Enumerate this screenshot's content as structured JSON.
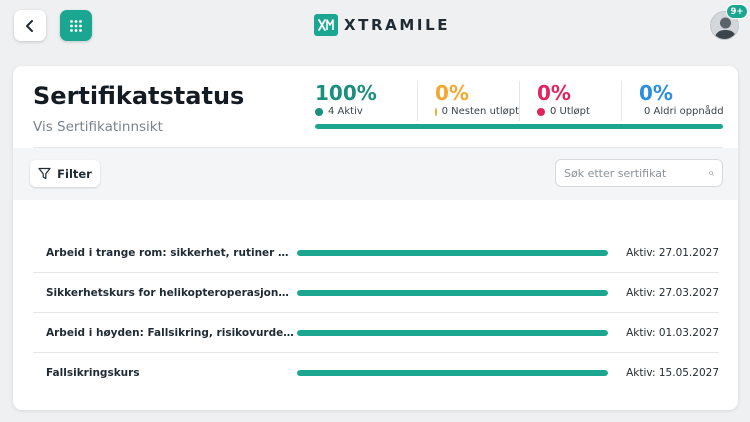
{
  "colors": {
    "accent": "#1aa691",
    "active": "#1a8f7b",
    "expiring": "#f0a830",
    "expired": "#e0245e",
    "never": "#2b8fe0"
  },
  "topbar": {
    "back_icon": "chevron-left-icon",
    "apps_icon": "grid-icon",
    "logo_text": "XTRAMILE",
    "notification_badge": "9+"
  },
  "header": {
    "title": "Sertifikatstatus",
    "subtitle": "Vis Sertifikatinnsikt"
  },
  "stats": [
    {
      "percent": "100%",
      "label": "4 Aktiv",
      "color": "#1a8f7b"
    },
    {
      "percent": "0%",
      "label": "0 Nesten utløpt",
      "color": "#f0a830"
    },
    {
      "percent": "0%",
      "label": "0 Utløpt",
      "color": "#e0245e"
    },
    {
      "percent": "0%",
      "label": "0 Aldri oppnådd",
      "color": "#2b8fe0"
    }
  ],
  "summary_progress": 1.0,
  "toolbar": {
    "filter_label": "Filter",
    "search_placeholder": "Søk etter sertifikat",
    "search_value": ""
  },
  "certificates": [
    {
      "name": "Arbeid i trange rom: sikkerhet, rutiner og redni...",
      "progress": 1.0,
      "status": "Aktiv: 27.01.2027"
    },
    {
      "name": "Sikkerhetskurs for helikopteroperasjoner (Tas...",
      "progress": 1.0,
      "status": "Aktiv: 27.03.2027"
    },
    {
      "name": "Arbeid i høyden: Fallsikring, risikovurdering og ...",
      "progress": 1.0,
      "status": "Aktiv: 01.03.2027"
    },
    {
      "name": "Fallsikringskurs",
      "progress": 1.0,
      "status": "Aktiv: 15.05.2027"
    }
  ]
}
